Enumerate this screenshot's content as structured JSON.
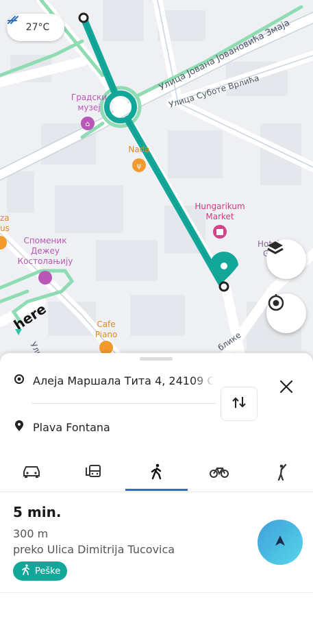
{
  "map": {
    "weather_temp": "27°C",
    "labels": {
      "street_jovan": "Улица Јована Јовановића Змаја",
      "street_subote": "Улица Суботе Врлића",
      "museum": [
        "Градски",
        "музеј"
      ],
      "nada": "Nada",
      "hungarikum": [
        "Hungarikum",
        "Market"
      ],
      "hotel": [
        "Hotel",
        "G"
      ],
      "spomenik": [
        "Споменик",
        "Дежеу",
        "Костолањију"
      ],
      "pizza": [
        "za",
        "us"
      ],
      "cafe": [
        "Cafe",
        "Piano"
      ],
      "street_uli": "Ули",
      "street_blike": "блике",
      "brand": "here"
    },
    "icons": {
      "weather": "wind-icon",
      "layers": "layers-icon",
      "locate": "locate-icon"
    }
  },
  "route": {
    "from": "Алеја Маршала Тита 4, 24109 С",
    "to": "Plava Fontana",
    "icons": {
      "from": "origin-circle-icon",
      "to": "location-pin-icon",
      "close": "close-icon",
      "swap": "swap-icon"
    }
  },
  "modes": [
    {
      "name": "car",
      "icon": "car-icon"
    },
    {
      "name": "transit",
      "icon": "bus-icon"
    },
    {
      "name": "walk",
      "icon": "walk-icon",
      "selected": true
    },
    {
      "name": "bike",
      "icon": "bicycle-icon"
    },
    {
      "name": "taxi",
      "icon": "hail-icon"
    }
  ],
  "result": {
    "duration": "5 min.",
    "distance": "300 m",
    "via": "preko Ulica Dimitrija Tucovica",
    "badge": "Peške"
  },
  "colors": {
    "route": "#13a79a",
    "accent_blue": "#2f6fb6",
    "green_street": "#8fdcb2",
    "start_gradient": [
      "#3e9fdc",
      "#58d6e8"
    ]
  }
}
